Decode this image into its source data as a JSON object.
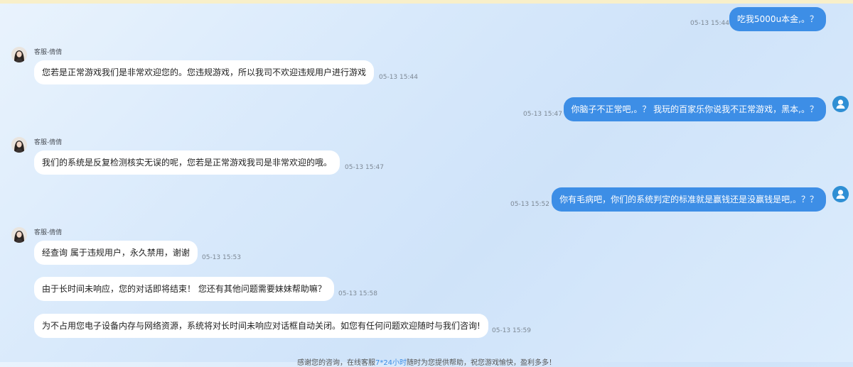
{
  "agent": {
    "name": "客服-倩倩"
  },
  "messages": [
    {
      "side": "user",
      "text": "吃我5000u本金,。？",
      "time": "05-13 15:44"
    },
    {
      "side": "agent",
      "text": "您若是正常游戏我们是非常欢迎您的。您违规游戏，所以我司不欢迎违规用户进行游戏",
      "time": "05-13 15:44"
    },
    {
      "side": "user",
      "text": "你脑子不正常吧,。？ 我玩的百家乐你说我不正常游戏，黑本,。？",
      "time": "05-13 15:47"
    },
    {
      "side": "agent",
      "text": "我们的系统是反复检测核实无误的呢，您若是正常游戏我司是非常欢迎的哦。",
      "time": "05-13 15:47"
    },
    {
      "side": "user",
      "text": "你有毛病吧，你们的系统判定的标准就是赢钱还是没赢钱是吧,。？？",
      "time": "05-13 15:52"
    },
    {
      "side": "agent",
      "text": "经查询 属于违规用户，永久禁用，谢谢",
      "time": "05-13 15:53"
    },
    {
      "side": "agent",
      "text": "由于长时间未响应，您的对话即将结束！ 您还有其他问题需要妹妹帮助嘛？",
      "time": "05-13 15:58"
    },
    {
      "side": "agent",
      "text": "为不占用您电子设备内存与网络资源，系统将对长时间未响应对话框自动关闭。如您有任何问题欢迎随时与我们咨询!",
      "time": "05-13 15:59"
    }
  ],
  "footer": {
    "prefix": "感谢您的咨询，在线客服",
    "link": "7*24小时",
    "suffix": "随时为您提供帮助，祝您游戏愉快，盈利多多！"
  },
  "colors": {
    "user_bubble": "#3d8ee6",
    "agent_bubble": "#ffffff",
    "top_banner": "#f8efc9",
    "user_avatar": "#2f8fd4"
  },
  "icons": {
    "agent_avatar": "woman-portrait-icon",
    "user_avatar": "user-silhouette-icon"
  }
}
